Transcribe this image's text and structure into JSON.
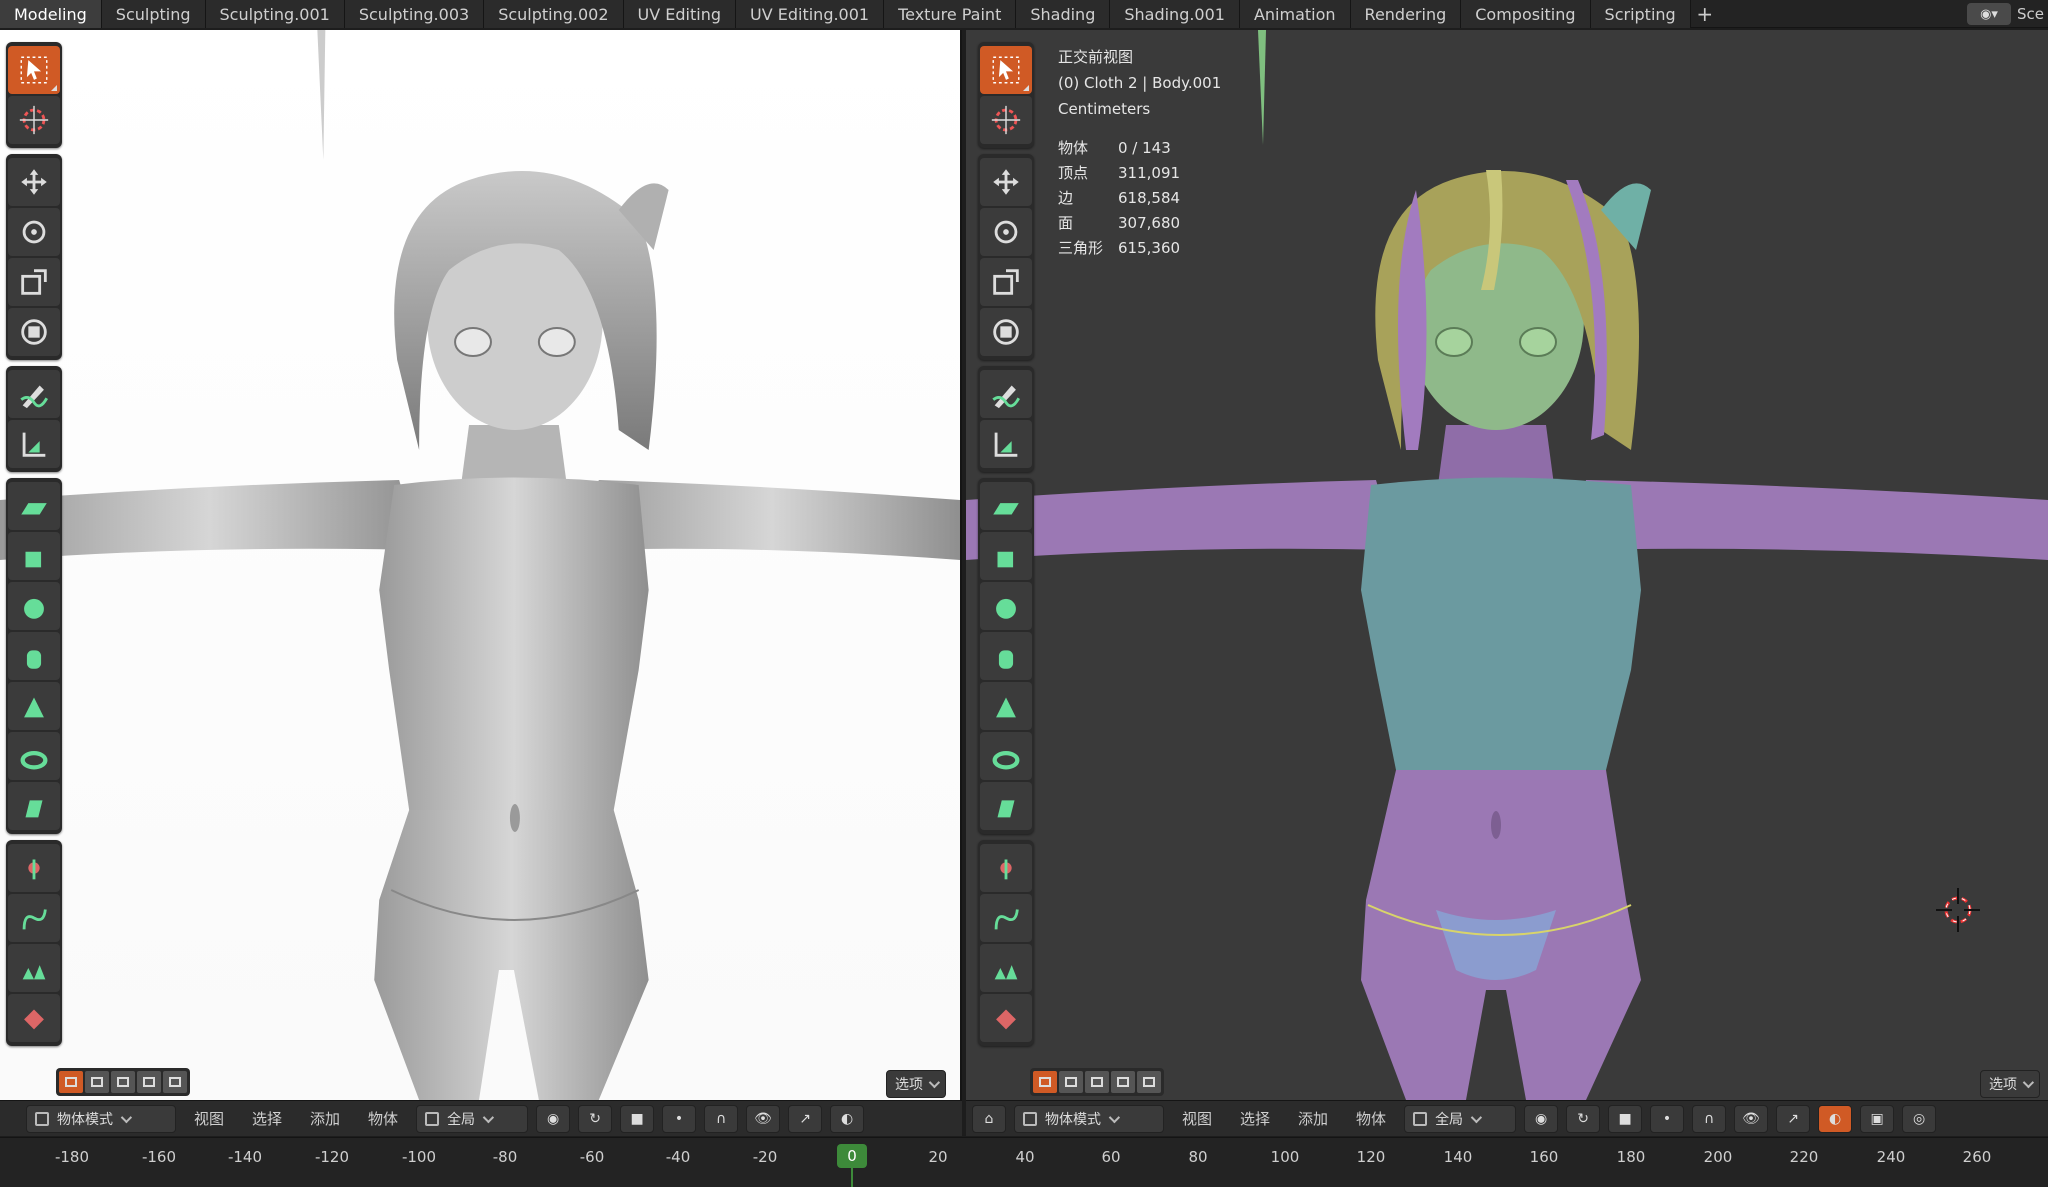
{
  "workspace_tabs": [
    "Modeling",
    "Sculpting",
    "Sculpting.001",
    "Sculpting.003",
    "Sculpting.002",
    "UV Editing",
    "UV Editing.001",
    "Texture Paint",
    "Shading",
    "Shading.001",
    "Animation",
    "Rendering",
    "Compositing",
    "Scripting"
  ],
  "add_tab_label": "+",
  "scene_label": "Sce",
  "viewport_right": {
    "view_name": "正交前视图",
    "object_info": "(0) Cloth 2 | Body.001",
    "units": "Centimeters",
    "stats": [
      {
        "key": "物体",
        "value": "0 / 143"
      },
      {
        "key": "顶点",
        "value": "311,091"
      },
      {
        "key": "边",
        "value": "618,584"
      },
      {
        "key": "面",
        "value": "307,680"
      },
      {
        "key": "三角形",
        "value": "615,360"
      }
    ]
  },
  "options_label": "选项",
  "header_left": {
    "mode": "物体模式",
    "menus": [
      "视图",
      "选择",
      "添加",
      "物体"
    ],
    "transform_orientation": "全局"
  },
  "header_right": {
    "mode": "物体模式",
    "menus": [
      "视图",
      "选择",
      "添加",
      "物体"
    ],
    "transform_orientation": "全局"
  },
  "timeline": {
    "current_frame": "0",
    "ticks": [
      "-180",
      "-160",
      "-140",
      "-120",
      "-100",
      "-80",
      "-60",
      "-40",
      "-20",
      "0",
      "20",
      "40",
      "60",
      "80",
      "100",
      "120",
      "140",
      "160",
      "180",
      "200",
      "220",
      "240",
      "260"
    ]
  },
  "colors": {
    "accent": "#d05a25",
    "frame_indicator": "#3d8a3a",
    "body_purple": "#9b78b4",
    "cloth_teal": "#6b9aa0",
    "skin_green": "#8fb98a"
  },
  "icons": [
    "select-box-icon",
    "cursor-icon",
    "move-icon",
    "rotate-icon",
    "scale-icon",
    "transform-icon",
    "annotate-icon",
    "measure-icon",
    "add-plane-icon",
    "add-cube-icon",
    "add-sphere-icon",
    "add-cylinder-icon",
    "add-cone-icon",
    "add-torus-icon",
    "add-prism-icon",
    "add-bone-icon",
    "add-curve-icon",
    "add-grass-icon",
    "add-gem-icon"
  ]
}
